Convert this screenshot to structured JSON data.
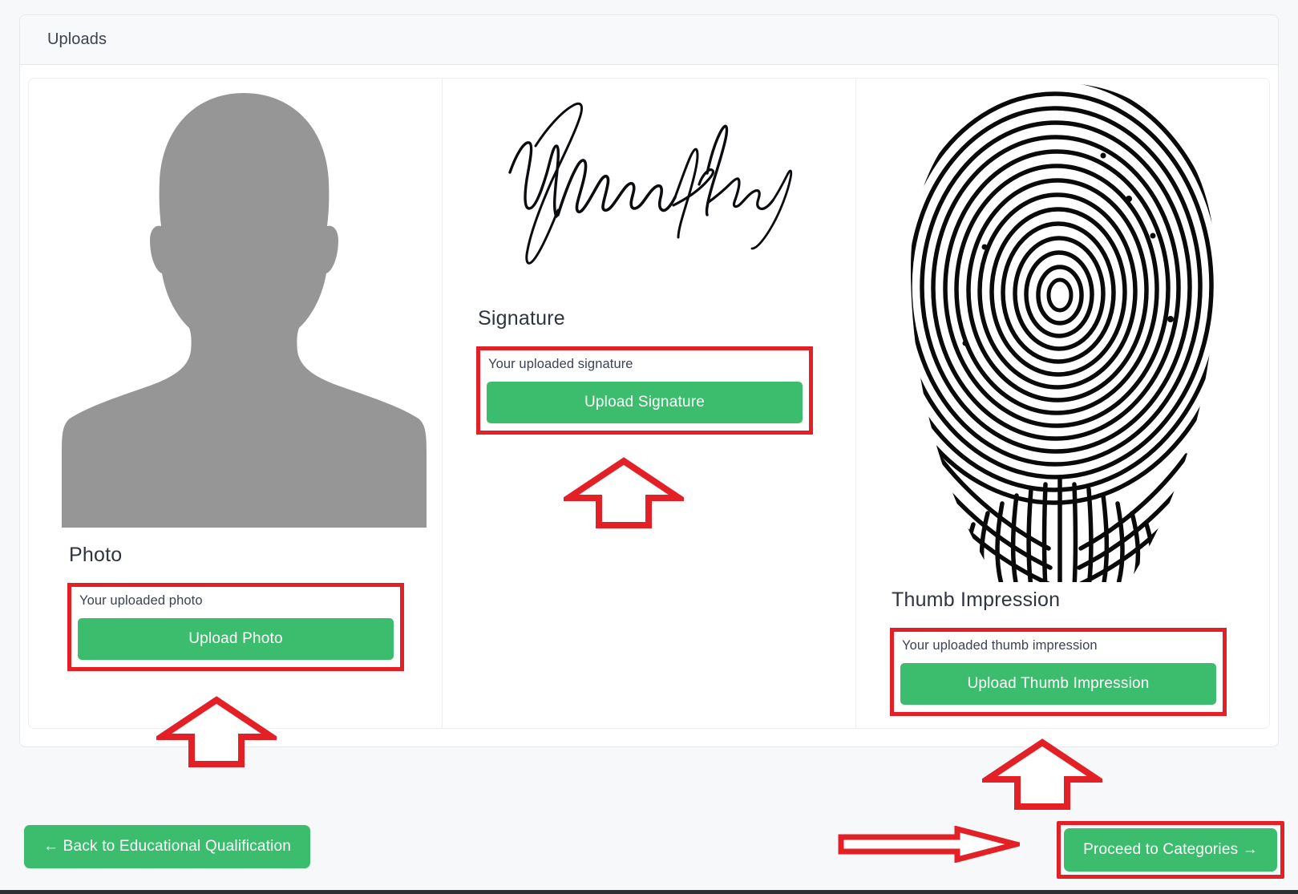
{
  "panel": {
    "header_title": "Uploads"
  },
  "cards": [
    {
      "id": "photo",
      "section_title": "Photo",
      "hint_text": "Your uploaded photo",
      "button_label": "Upload Photo",
      "media_icon": "person-silhouette-placeholder-image",
      "annotation": "red-highlight-box",
      "arrow": "up-arrow-annotation"
    },
    {
      "id": "signature",
      "section_title": "Signature",
      "hint_text": "Your uploaded signature",
      "button_label": "Upload Signature",
      "media_icon": "handwritten-signature-image",
      "annotation": "red-highlight-box",
      "arrow": "up-arrow-annotation"
    },
    {
      "id": "thumb",
      "section_title": "Thumb Impression",
      "hint_text": "Your uploaded thumb impression",
      "button_label": "Upload Thumb Impression",
      "media_icon": "fingerprint-image",
      "annotation": "red-highlight-box",
      "arrow": "up-arrow-annotation"
    }
  ],
  "footer": {
    "back_label": "← Back to Educational Qualification",
    "proceed_label": "Proceed to Categories →",
    "proceed_arrow_icon": "right-arrow-annotation"
  },
  "colors": {
    "accent_green": "#3cbc6d",
    "annotation_red": "#e32026",
    "page_background": "#f7f8fa",
    "header_background": "#f8f9fa",
    "card_border": "#eceef1",
    "text_primary": "#2e3440",
    "placeholder_gray": "#969696"
  }
}
